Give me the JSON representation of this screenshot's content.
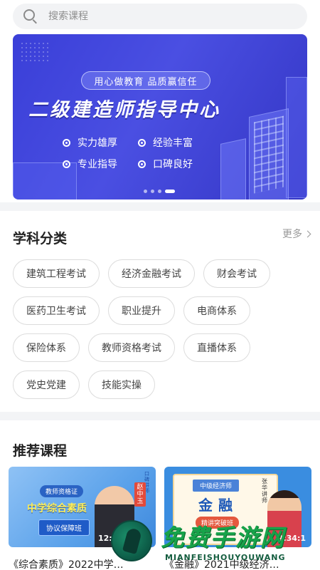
{
  "search": {
    "placeholder": "搜索课程"
  },
  "banner": {
    "pill": "用心做教育 品质赢信任",
    "headline": "二级建造师指导中心",
    "features": [
      "实力雄厚",
      "经验丰富",
      "专业指导",
      "口碑良好"
    ],
    "page_count": 4,
    "active_index": 3
  },
  "subjects": {
    "title": "学科分类",
    "more_label": "更多",
    "rows": [
      [
        "建筑工程考试",
        "经济金融考试",
        "财会考试"
      ],
      [
        "医药卫生考试",
        "职业提升",
        "电商体系"
      ],
      [
        "保险体系",
        "教师资格考试",
        "直播体系"
      ],
      [
        "党史党建",
        "技能实操"
      ]
    ]
  },
  "recommend": {
    "title": "推荐课程",
    "courses": [
      {
        "caption": "《综合素质》2022中学…",
        "thumb_badge": "教师资格证",
        "thumb_title": "中学综合素质",
        "thumb_button": "协议保障班",
        "thumb_name": "赵中玉",
        "thumb_role": "口碑讲师",
        "timestamp": "12:3"
      },
      {
        "caption": "《金融》2021中级经济…",
        "thumb_badge": "中级经济师",
        "thumb_title": "金融",
        "thumb_button": "精讲突破班",
        "thumb_name": "张华",
        "thumb_role": "讲师",
        "timestamp": "2:34:1"
      }
    ]
  },
  "watermark": {
    "text": "免费手游网",
    "url": "MIANFEISHOUYOUWANG"
  }
}
